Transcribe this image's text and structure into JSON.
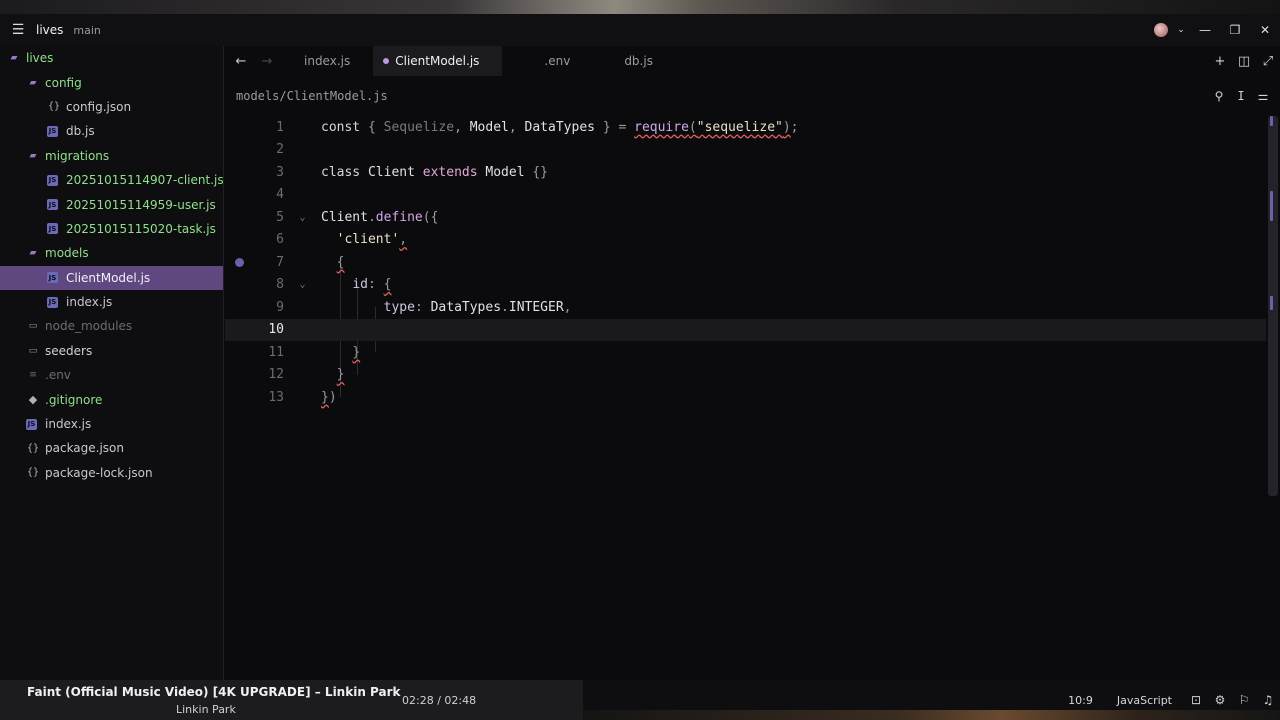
{
  "titlebar": {
    "project": "lives",
    "branch": "main",
    "icons": [
      "menu-icon",
      "avatar",
      "chevron-down-icon",
      "minimize-icon",
      "maximize-icon",
      "close-icon"
    ]
  },
  "sidebar": {
    "items": [
      {
        "label": "lives",
        "icon": "folder-open-icon"
      },
      {
        "label": "config",
        "icon": "folder-open-icon"
      },
      {
        "label": "config.json",
        "icon": "json-icon"
      },
      {
        "label": "db.js",
        "icon": "js-icon"
      },
      {
        "label": "migrations",
        "icon": "folder-open-icon"
      },
      {
        "label": "20251015114907-client.js",
        "icon": "js-icon"
      },
      {
        "label": "20251015114959-user.js",
        "icon": "js-icon"
      },
      {
        "label": "20251015115020-task.js",
        "icon": "js-icon"
      },
      {
        "label": "models",
        "icon": "folder-open-icon"
      },
      {
        "label": "ClientModel.js",
        "icon": "js-icon"
      },
      {
        "label": "index.js",
        "icon": "js-icon"
      },
      {
        "label": "node_modules",
        "icon": "folder-icon"
      },
      {
        "label": "seeders",
        "icon": "folder-icon"
      },
      {
        "label": ".env",
        "icon": "file-icon"
      },
      {
        "label": ".gitignore",
        "icon": "git-icon"
      },
      {
        "label": "index.js",
        "icon": "js-icon"
      },
      {
        "label": "package.json",
        "icon": "json-icon"
      },
      {
        "label": "package-lock.json",
        "icon": "json-icon"
      }
    ]
  },
  "tabs": [
    {
      "label": "index.js",
      "active": false
    },
    {
      "label": "ClientModel.js",
      "active": true
    },
    {
      "label": ".env",
      "active": false
    },
    {
      "label": "db.js",
      "active": false
    }
  ],
  "breadcrumb": "models/ClientModel.js",
  "code": {
    "current_line": 10,
    "breakpoint_line": 7,
    "line_numbers": [
      "1",
      "2",
      "3",
      "4",
      "5",
      "6",
      "7",
      "8",
      "9",
      "10",
      "11",
      "12",
      "13"
    ]
  },
  "status": {
    "media_title": "Faint (Official Music Video) [4K UPGRADE] – Linkin Park",
    "media_artist": "Linkin Park",
    "media_time": "02:28 / 02:48",
    "cursor": "10:9",
    "language": "JavaScript"
  },
  "colors": {
    "accent": "#5f4880",
    "green": "#8fe08a",
    "breakpoint": "#6a62a8"
  }
}
